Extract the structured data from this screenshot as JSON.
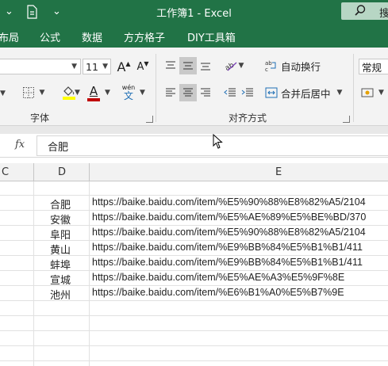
{
  "window": {
    "title": "工作簿1  -  Excel",
    "search_label": "搜"
  },
  "quick_access": {
    "undo_chevron": "⌄",
    "more_chevron": "⌄"
  },
  "menu": [
    "布局",
    "公式",
    "数据",
    "方方格子",
    "DIY工具箱"
  ],
  "ribbon": {
    "font_size": "11",
    "grow_font": "A",
    "shrink_font": "A",
    "font_color_letter": "A",
    "phonetic_top": "wén",
    "phonetic_bottom": "文",
    "wrap_text": "自动换行",
    "merge_center": "合并后居中",
    "number_format": "常规",
    "group_font": "字体",
    "group_alignment": "对齐方式"
  },
  "formula_bar": {
    "fx": "fx",
    "value": "合肥"
  },
  "columns": [
    "C",
    "D",
    "E"
  ],
  "rows": [
    {
      "d": "合肥",
      "e": "https://baike.baidu.com/item/%E5%90%88%E8%82%A5/2104"
    },
    {
      "d": "安徽",
      "e": "https://baike.baidu.com/item/%E5%AE%89%E5%BE%BD/370"
    },
    {
      "d": "阜阳",
      "e": "https://baike.baidu.com/item/%E5%90%88%E8%82%A5/2104"
    },
    {
      "d": "黄山",
      "e": "https://baike.baidu.com/item/%E9%BB%84%E5%B1%B1/411"
    },
    {
      "d": "蚌埠",
      "e": "https://baike.baidu.com/item/%E9%BB%84%E5%B1%B1/411"
    },
    {
      "d": "宣城",
      "e": "https://baike.baidu.com/item/%E5%AE%A3%E5%9F%8E"
    },
    {
      "d": "池州",
      "e": "https://baike.baidu.com/item/%E6%B1%A0%E5%B7%9E"
    }
  ],
  "colors": {
    "excel_green": "#217346",
    "font_color_bar": "#c00000",
    "highlight_bar": "#ffff00"
  }
}
